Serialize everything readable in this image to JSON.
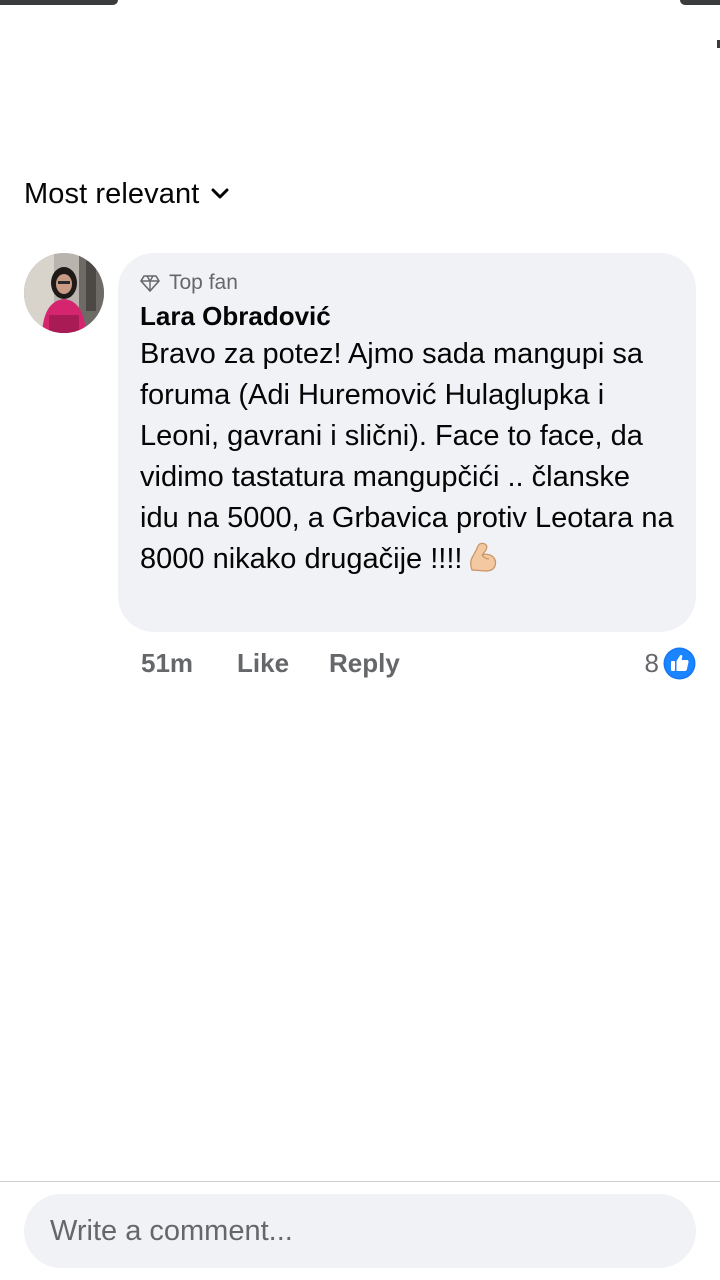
{
  "sort": {
    "label": "Most relevant",
    "icon": "chevron-down-icon"
  },
  "comment": {
    "badge": {
      "icon": "diamond-icon",
      "label": "Top fan"
    },
    "author": "Lara Obradović",
    "text": "Bravo za potez! Ajmo sada mangupi sa foruma (Adi Huremović Hulaglupka i Leoni, gavrani i slični). Face to face, da vidimo tastatura mangupčići .. članske idu na 5000, a Grbavica protiv Leotara na 8000 nikako drugačije !!!!",
    "emoji": "flexed-biceps-emoji",
    "time": "51m",
    "like_label": "Like",
    "reply_label": "Reply",
    "reaction_count": "8",
    "reaction_icon": "like-thumb-icon"
  },
  "composer": {
    "placeholder": "Write a comment..."
  },
  "colors": {
    "bubble": "#f0f2f5",
    "secondary_text": "#65676b",
    "like_blue": "#1877f2",
    "primary_text": "#050505"
  }
}
